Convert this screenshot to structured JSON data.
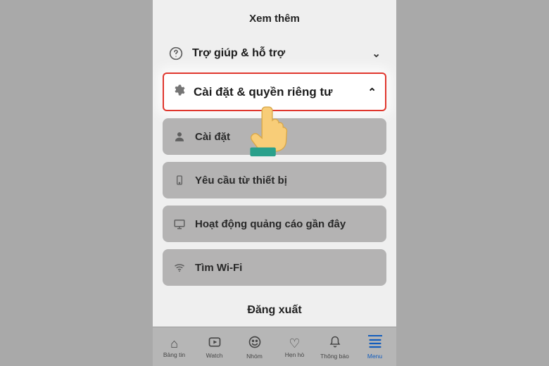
{
  "seeMore": "Xem thêm",
  "help": {
    "label": "Trợ giúp & hỗ trợ"
  },
  "settings": {
    "label": "Cài đặt & quyền riêng tư",
    "items": [
      {
        "label": "Cài đặt",
        "icon": "person"
      },
      {
        "label": "Yêu cầu từ thiết bị",
        "icon": "phone"
      },
      {
        "label": "Hoạt động quảng cáo gần đây",
        "icon": "screen"
      },
      {
        "label": "Tìm Wi-Fi",
        "icon": "wifi"
      }
    ]
  },
  "logout": "Đăng xuất",
  "tabs": [
    {
      "label": "Bảng tin",
      "icon": "⌂"
    },
    {
      "label": "Watch",
      "icon": "▶"
    },
    {
      "label": "Nhóm",
      "icon": "☺"
    },
    {
      "label": "Hẹn hò",
      "icon": "♡"
    },
    {
      "label": "Thông báo",
      "icon": "✿"
    },
    {
      "label": "Menu",
      "icon": "≡"
    }
  ]
}
